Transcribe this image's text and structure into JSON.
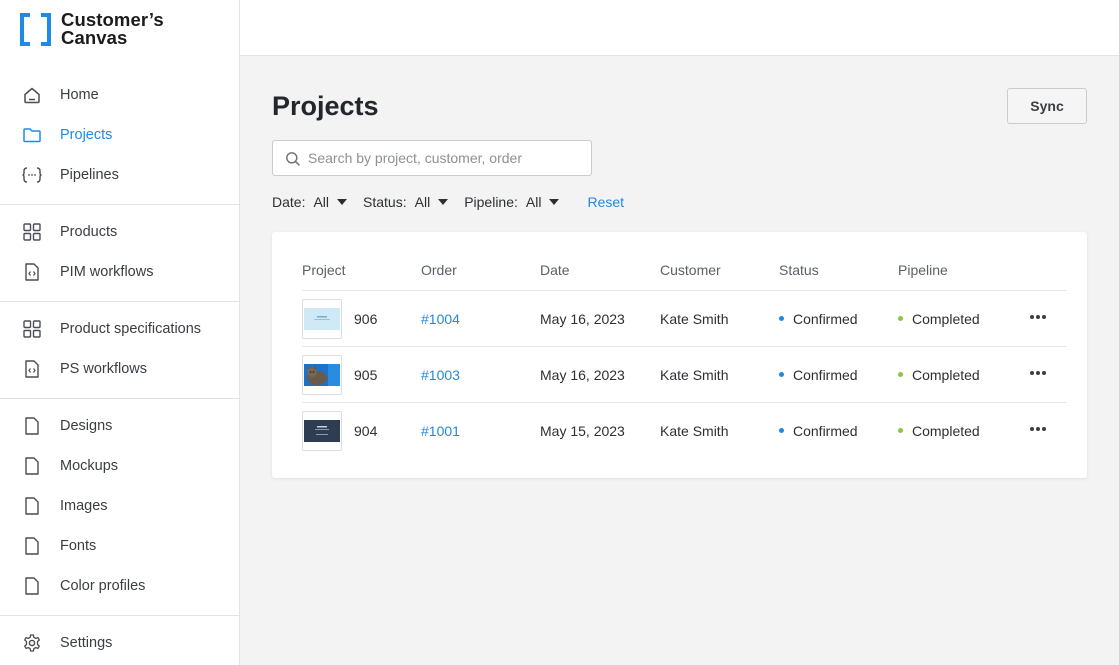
{
  "app": {
    "logo_line1": "Customer’s",
    "logo_line2": "Canvas",
    "accent": "#1f8ae6"
  },
  "sidebar": {
    "items": [
      {
        "label": "Home",
        "icon": "home-icon",
        "active": false
      },
      {
        "label": "Projects",
        "icon": "folder-icon",
        "active": true
      },
      {
        "label": "Pipelines",
        "icon": "braces-icon",
        "active": false
      },
      {
        "label": "Products",
        "icon": "grid-icon",
        "active": false
      },
      {
        "label": "PIM workflows",
        "icon": "code-file-icon",
        "active": false
      },
      {
        "label": "Product specifications",
        "icon": "grid-icon",
        "active": false
      },
      {
        "label": "PS workflows",
        "icon": "code-file-icon",
        "active": false
      },
      {
        "label": "Designs",
        "icon": "file-icon",
        "active": false
      },
      {
        "label": "Mockups",
        "icon": "file-icon",
        "active": false
      },
      {
        "label": "Images",
        "icon": "file-icon",
        "active": false
      },
      {
        "label": "Fonts",
        "icon": "file-icon",
        "active": false
      },
      {
        "label": "Color profiles",
        "icon": "file-icon",
        "active": false
      },
      {
        "label": "Settings",
        "icon": "gear-icon",
        "active": false
      }
    ]
  },
  "main": {
    "title": "Projects",
    "sync_label": "Sync",
    "search": {
      "placeholder": "Search by project, customer, order",
      "value": ""
    },
    "filters": [
      {
        "label": "Date:",
        "value": "All"
      },
      {
        "label": "Status:",
        "value": "All"
      },
      {
        "label": "Pipeline:",
        "value": "All"
      }
    ],
    "reset_label": "Reset"
  },
  "table": {
    "columns": [
      "Project",
      "Order",
      "Date",
      "Customer",
      "Status",
      "Pipeline"
    ],
    "rows": [
      {
        "project": "906",
        "order": "#1004",
        "date": "May 16, 2023",
        "customer": "Kate Smith",
        "status": "Confirmed",
        "pipeline": "Completed",
        "thumb": "light-blue-card"
      },
      {
        "project": "905",
        "order": "#1003",
        "date": "May 16, 2023",
        "customer": "Kate Smith",
        "status": "Confirmed",
        "pipeline": "Completed",
        "thumb": "cat-photo"
      },
      {
        "project": "904",
        "order": "#1001",
        "date": "May 15, 2023",
        "customer": "Kate Smith",
        "status": "Confirmed",
        "pipeline": "Completed",
        "thumb": "dark-card"
      }
    ],
    "status_color": "#1f8ae6",
    "pipeline_color": "#8cc63f"
  }
}
